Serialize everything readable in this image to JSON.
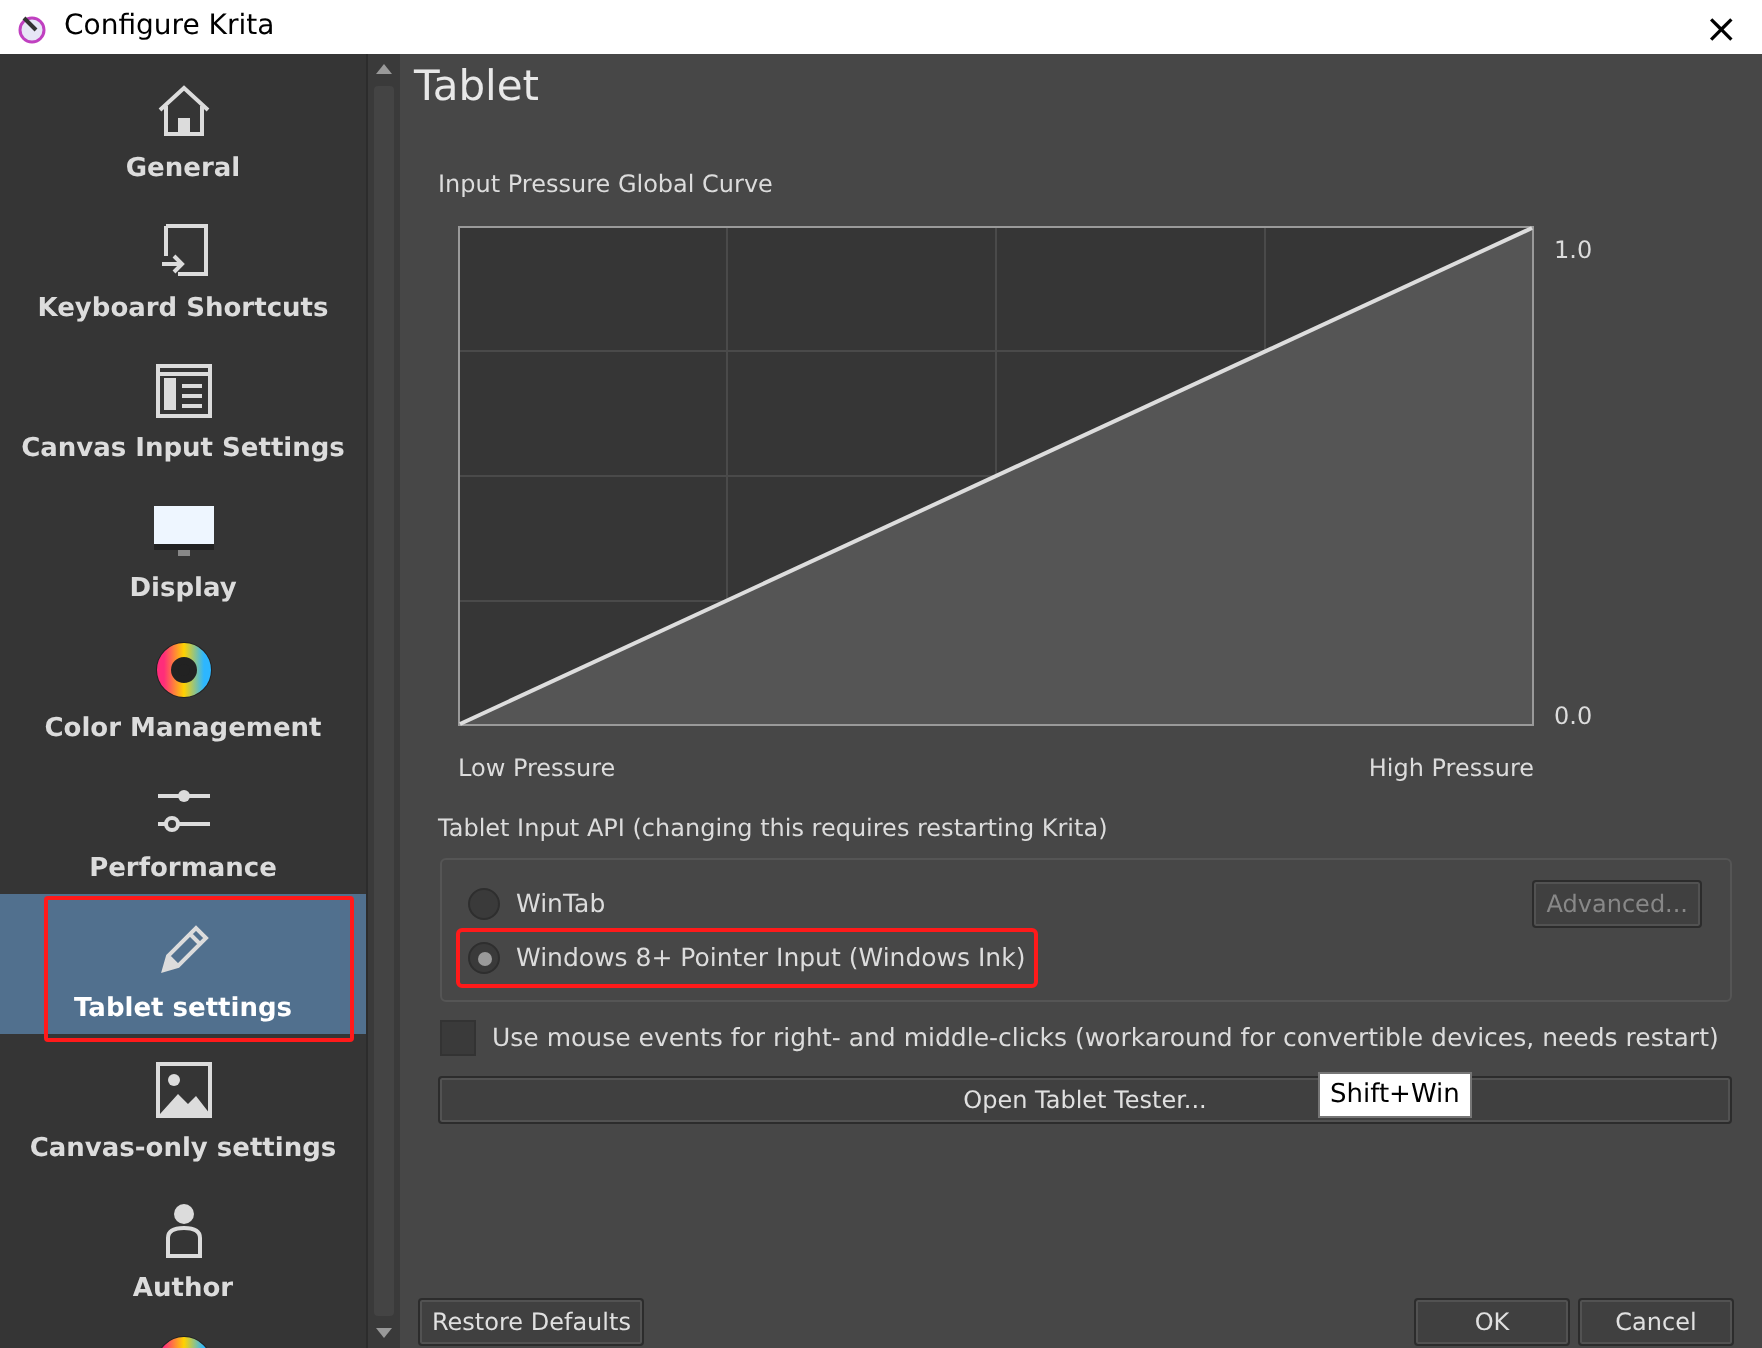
{
  "window": {
    "title": "Configure Krita",
    "close": "×"
  },
  "sidebar": {
    "items": [
      {
        "label": "General",
        "selected": false,
        "highlighted": false
      },
      {
        "label": "Keyboard Shortcuts",
        "selected": false,
        "highlighted": false
      },
      {
        "label": "Canvas Input Settings",
        "selected": false,
        "highlighted": false
      },
      {
        "label": "Display",
        "selected": false,
        "highlighted": false
      },
      {
        "label": "Color Management",
        "selected": false,
        "highlighted": false
      },
      {
        "label": "Performance",
        "selected": false,
        "highlighted": false
      },
      {
        "label": "Tablet settings",
        "selected": true,
        "highlighted": true
      },
      {
        "label": "Canvas-only settings",
        "selected": false,
        "highlighted": false
      },
      {
        "label": "Author",
        "selected": false,
        "highlighted": false
      }
    ]
  },
  "page": {
    "title": "Tablet",
    "curve": {
      "title": "Input Pressure Global Curve",
      "top_label": "1.0",
      "bottom_label": "0.0",
      "left_label": "Low Pressure",
      "right_label": "High Pressure"
    },
    "api": {
      "title": "Tablet Input API (changing this requires restarting Krita)",
      "options": [
        {
          "label": "WinTab",
          "selected": false,
          "highlighted": false
        },
        {
          "label": "Windows 8+ Pointer Input (Windows Ink)",
          "selected": true,
          "highlighted": true
        }
      ],
      "advanced": {
        "label": "Advanced...",
        "disabled": true
      }
    },
    "mouse_events": {
      "label": "Use mouse events for right- and middle-clicks (workaround for convertible devices, needs restart)",
      "checked": false
    },
    "tester_button": "Open Tablet Tester...",
    "tooltip": "Shift+Win"
  },
  "buttons": {
    "restore": "Restore Defaults",
    "ok": "OK",
    "cancel": "Cancel"
  }
}
